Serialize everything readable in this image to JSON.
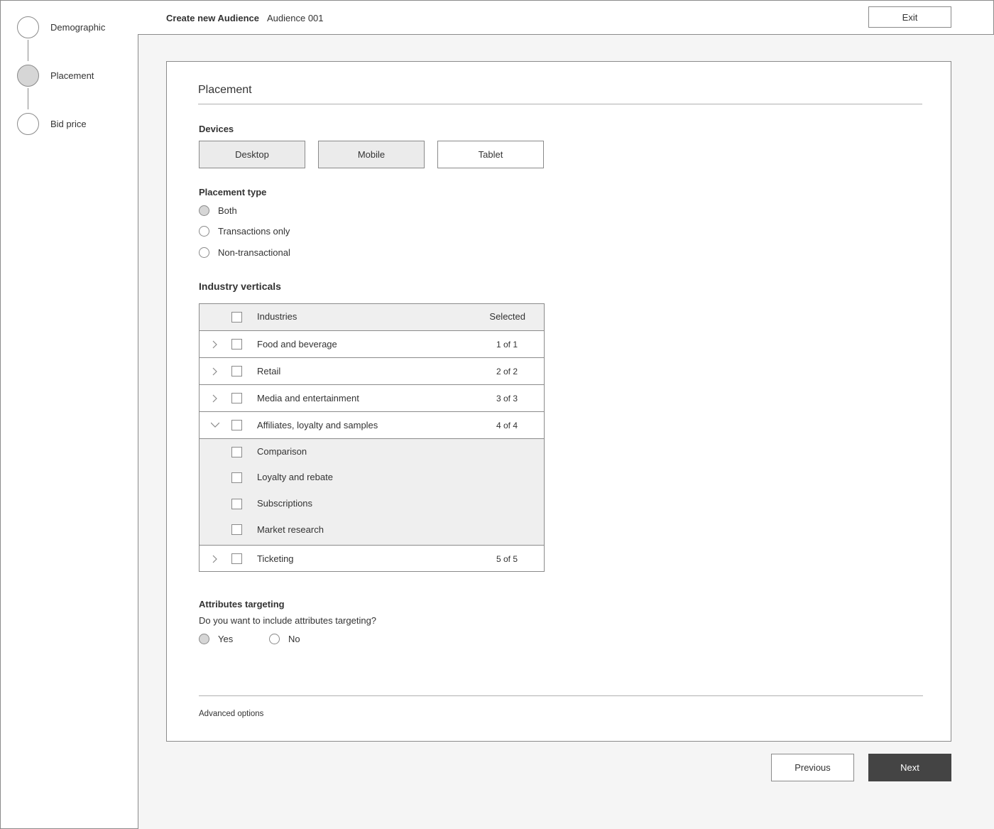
{
  "sidebar": {
    "steps": [
      {
        "label": "Demographic",
        "active": false
      },
      {
        "label": "Placement",
        "active": true
      },
      {
        "label": "Bid price",
        "active": false
      }
    ]
  },
  "header": {
    "title": "Create new Audience",
    "subtitle": "Audience 001",
    "exit_label": "Exit"
  },
  "card": {
    "title": "Placement",
    "devices": {
      "label": "Devices",
      "options": [
        {
          "label": "Desktop",
          "selected": true
        },
        {
          "label": "Mobile",
          "selected": true
        },
        {
          "label": "Tablet",
          "selected": false
        }
      ]
    },
    "placement_type": {
      "label": "Placement type",
      "options": [
        {
          "label": "Both",
          "checked": true
        },
        {
          "label": "Transactions only",
          "checked": false
        },
        {
          "label": "Non-transactional",
          "checked": false
        }
      ]
    },
    "industry": {
      "label": "Industry verticals",
      "col_industries": "Industries",
      "col_selected": "Selected",
      "rows": [
        {
          "label": "Food and beverage",
          "count": "1 of 1"
        },
        {
          "label": "Retail",
          "count": "2 of 2"
        },
        {
          "label": "Media and entertainment",
          "count": "3 of 3"
        },
        {
          "label": "Affiliates, loyalty and samples",
          "count": "4 of 4"
        },
        {
          "label": "Ticketing",
          "count": "5 of 5"
        }
      ],
      "sub_rows": [
        {
          "label": "Comparison"
        },
        {
          "label": "Loyalty and rebate"
        },
        {
          "label": "Subscriptions"
        },
        {
          "label": "Market research"
        }
      ]
    },
    "attributes": {
      "label": "Attributes targeting",
      "question": "Do you want to include attributes targeting?",
      "yes": "Yes",
      "no": "No"
    },
    "advanced": "Advanced options"
  },
  "footer": {
    "previous": "Previous",
    "next": "Next"
  },
  "colors": {
    "border": "#8a8a8a",
    "selected_fill": "#ebebeb",
    "primary_button": "#444444"
  }
}
